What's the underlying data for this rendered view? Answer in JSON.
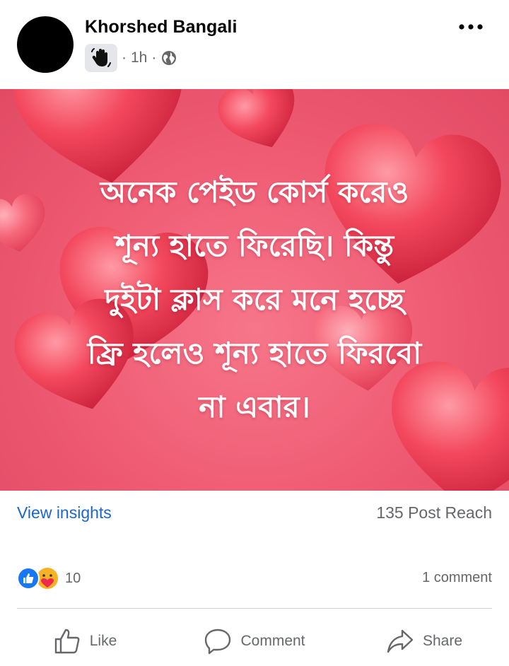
{
  "post": {
    "author": "Khorshed Bangali",
    "time": "1h",
    "separator": "·",
    "icons": {
      "badge": "waving-hand-icon",
      "privacy": "globe-icon",
      "menu": "more-horizontal-icon"
    },
    "image_text": "অনেক পেইড কোর্স করেও\nশূন্য হাতে ফিরেছি। কিন্তু\nদুইটা ক্লাস করে মনে হচ্ছে\nফ্রি হলেও শূন্য হাতে ফিরবো\nনা এবার।",
    "image_colors": {
      "background": "#ee5a72",
      "hearts": "#f2384f"
    }
  },
  "stats": {
    "insights_label": "View insights",
    "reach_label": "135 Post Reach",
    "reaction_count": "10",
    "reaction_types": [
      "like-reaction-icon",
      "care-reaction-icon"
    ],
    "comments_label": "1 comment"
  },
  "actions": {
    "like": "Like",
    "comment": "Comment",
    "share": "Share"
  },
  "colors": {
    "link": "#1b66c9",
    "secondary_text": "#65676b",
    "like_blue": "#1877f2"
  }
}
